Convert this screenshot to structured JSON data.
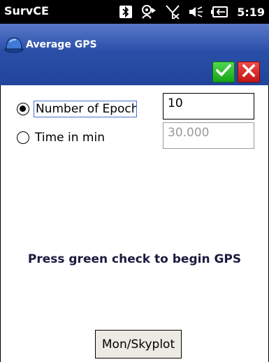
{
  "status_bar": {
    "app_name": "SurvCE",
    "time": "5:19",
    "icons": [
      "bluetooth-icon",
      "gps-signal-icon",
      "no-signal-icon",
      "volume-icon",
      "battery-icon"
    ]
  },
  "header": {
    "title": "Average GPS",
    "icon": "helmet-icon",
    "ok_icon": "check-icon",
    "cancel_icon": "close-icon",
    "colors": {
      "gradient_top": "#5a78c8",
      "gradient_bottom": "#22449a",
      "ok": "#15a515",
      "cancel": "#c41414"
    }
  },
  "options": [
    {
      "label": "Number of Epochs",
      "selected": true,
      "value": "10",
      "enabled": true
    },
    {
      "label": "Time in min",
      "selected": false,
      "value": "30.000",
      "enabled": false
    }
  ],
  "message": "Press green check to begin GPS",
  "mon_button_label": "Mon/Skyplot"
}
